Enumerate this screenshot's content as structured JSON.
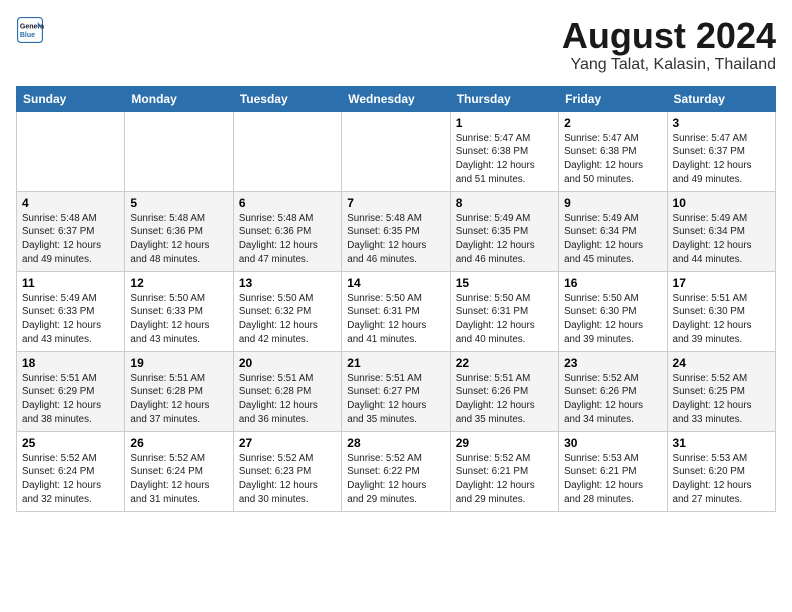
{
  "header": {
    "logo_line1": "General",
    "logo_line2": "Blue",
    "title": "August 2024",
    "subtitle": "Yang Talat, Kalasin, Thailand"
  },
  "weekdays": [
    "Sunday",
    "Monday",
    "Tuesday",
    "Wednesday",
    "Thursday",
    "Friday",
    "Saturday"
  ],
  "weeks": [
    [
      {
        "day": "",
        "info": ""
      },
      {
        "day": "",
        "info": ""
      },
      {
        "day": "",
        "info": ""
      },
      {
        "day": "",
        "info": ""
      },
      {
        "day": "1",
        "info": "Sunrise: 5:47 AM\nSunset: 6:38 PM\nDaylight: 12 hours\nand 51 minutes."
      },
      {
        "day": "2",
        "info": "Sunrise: 5:47 AM\nSunset: 6:38 PM\nDaylight: 12 hours\nand 50 minutes."
      },
      {
        "day": "3",
        "info": "Sunrise: 5:47 AM\nSunset: 6:37 PM\nDaylight: 12 hours\nand 49 minutes."
      }
    ],
    [
      {
        "day": "4",
        "info": "Sunrise: 5:48 AM\nSunset: 6:37 PM\nDaylight: 12 hours\nand 49 minutes."
      },
      {
        "day": "5",
        "info": "Sunrise: 5:48 AM\nSunset: 6:36 PM\nDaylight: 12 hours\nand 48 minutes."
      },
      {
        "day": "6",
        "info": "Sunrise: 5:48 AM\nSunset: 6:36 PM\nDaylight: 12 hours\nand 47 minutes."
      },
      {
        "day": "7",
        "info": "Sunrise: 5:48 AM\nSunset: 6:35 PM\nDaylight: 12 hours\nand 46 minutes."
      },
      {
        "day": "8",
        "info": "Sunrise: 5:49 AM\nSunset: 6:35 PM\nDaylight: 12 hours\nand 46 minutes."
      },
      {
        "day": "9",
        "info": "Sunrise: 5:49 AM\nSunset: 6:34 PM\nDaylight: 12 hours\nand 45 minutes."
      },
      {
        "day": "10",
        "info": "Sunrise: 5:49 AM\nSunset: 6:34 PM\nDaylight: 12 hours\nand 44 minutes."
      }
    ],
    [
      {
        "day": "11",
        "info": "Sunrise: 5:49 AM\nSunset: 6:33 PM\nDaylight: 12 hours\nand 43 minutes."
      },
      {
        "day": "12",
        "info": "Sunrise: 5:50 AM\nSunset: 6:33 PM\nDaylight: 12 hours\nand 43 minutes."
      },
      {
        "day": "13",
        "info": "Sunrise: 5:50 AM\nSunset: 6:32 PM\nDaylight: 12 hours\nand 42 minutes."
      },
      {
        "day": "14",
        "info": "Sunrise: 5:50 AM\nSunset: 6:31 PM\nDaylight: 12 hours\nand 41 minutes."
      },
      {
        "day": "15",
        "info": "Sunrise: 5:50 AM\nSunset: 6:31 PM\nDaylight: 12 hours\nand 40 minutes."
      },
      {
        "day": "16",
        "info": "Sunrise: 5:50 AM\nSunset: 6:30 PM\nDaylight: 12 hours\nand 39 minutes."
      },
      {
        "day": "17",
        "info": "Sunrise: 5:51 AM\nSunset: 6:30 PM\nDaylight: 12 hours\nand 39 minutes."
      }
    ],
    [
      {
        "day": "18",
        "info": "Sunrise: 5:51 AM\nSunset: 6:29 PM\nDaylight: 12 hours\nand 38 minutes."
      },
      {
        "day": "19",
        "info": "Sunrise: 5:51 AM\nSunset: 6:28 PM\nDaylight: 12 hours\nand 37 minutes."
      },
      {
        "day": "20",
        "info": "Sunrise: 5:51 AM\nSunset: 6:28 PM\nDaylight: 12 hours\nand 36 minutes."
      },
      {
        "day": "21",
        "info": "Sunrise: 5:51 AM\nSunset: 6:27 PM\nDaylight: 12 hours\nand 35 minutes."
      },
      {
        "day": "22",
        "info": "Sunrise: 5:51 AM\nSunset: 6:26 PM\nDaylight: 12 hours\nand 35 minutes."
      },
      {
        "day": "23",
        "info": "Sunrise: 5:52 AM\nSunset: 6:26 PM\nDaylight: 12 hours\nand 34 minutes."
      },
      {
        "day": "24",
        "info": "Sunrise: 5:52 AM\nSunset: 6:25 PM\nDaylight: 12 hours\nand 33 minutes."
      }
    ],
    [
      {
        "day": "25",
        "info": "Sunrise: 5:52 AM\nSunset: 6:24 PM\nDaylight: 12 hours\nand 32 minutes."
      },
      {
        "day": "26",
        "info": "Sunrise: 5:52 AM\nSunset: 6:24 PM\nDaylight: 12 hours\nand 31 minutes."
      },
      {
        "day": "27",
        "info": "Sunrise: 5:52 AM\nSunset: 6:23 PM\nDaylight: 12 hours\nand 30 minutes."
      },
      {
        "day": "28",
        "info": "Sunrise: 5:52 AM\nSunset: 6:22 PM\nDaylight: 12 hours\nand 29 minutes."
      },
      {
        "day": "29",
        "info": "Sunrise: 5:52 AM\nSunset: 6:21 PM\nDaylight: 12 hours\nand 29 minutes."
      },
      {
        "day": "30",
        "info": "Sunrise: 5:53 AM\nSunset: 6:21 PM\nDaylight: 12 hours\nand 28 minutes."
      },
      {
        "day": "31",
        "info": "Sunrise: 5:53 AM\nSunset: 6:20 PM\nDaylight: 12 hours\nand 27 minutes."
      }
    ]
  ]
}
